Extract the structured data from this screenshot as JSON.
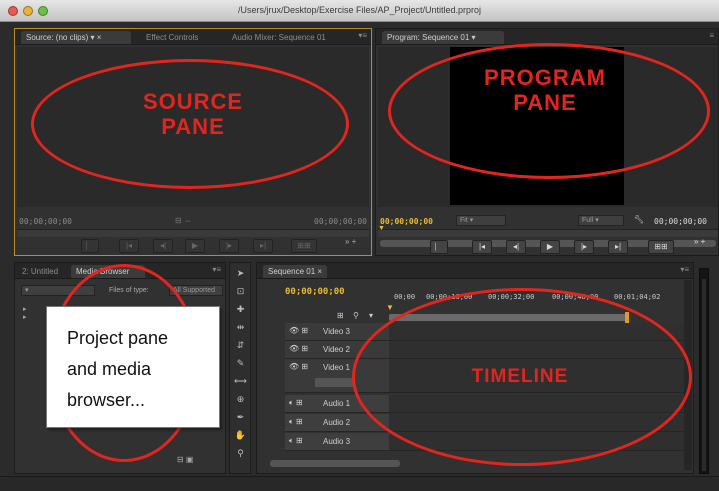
{
  "window": {
    "title": "/Users/jrux/Desktop/Exercise Files/AP_Project/Untitled.prproj"
  },
  "source_panel": {
    "tabs": [
      "Source: (no clips)",
      "Effect Controls",
      "Audio Mixer: Sequence 01"
    ],
    "timecode_in": "00;00;00;00",
    "timecode_out": "00;00;00;00"
  },
  "program_panel": {
    "tab": "Program: Sequence 01",
    "timecode_current": "00;00;00;00",
    "fit_label": "Fit",
    "quality_label": "Full",
    "timecode_duration": "00;00;00;00"
  },
  "project_panel": {
    "tabs": [
      "2: Untitled",
      "Media Browser"
    ],
    "files_of_type_label": "Files of type:",
    "files_of_type_value": "All Supported"
  },
  "timeline_panel": {
    "tab": "Sequence 01",
    "timecode": "00;00;00;00",
    "ruler_ticks": [
      "00;00",
      "00;00;16;00",
      "00;00;32;00",
      "00;00;48;00",
      "00;01;04;02"
    ],
    "tracks": [
      {
        "name": "Video 3",
        "kind": "video"
      },
      {
        "name": "Video 2",
        "kind": "video"
      },
      {
        "name": "Video 1",
        "kind": "video"
      },
      {
        "name": "Audio 1",
        "kind": "audio"
      },
      {
        "name": "Audio 2",
        "kind": "audio"
      },
      {
        "name": "Audio 3",
        "kind": "audio"
      }
    ]
  },
  "annotations": {
    "source": "SOURCE\nPANE",
    "program": "PROGRAM\nPANE",
    "timeline": "TIMELINE",
    "callout": "Project pane\nand media\nbrowser...",
    "color": "#e1261f"
  },
  "colors": {
    "accent_timecode": "#e9bb32",
    "active_panel_border": "#b98c2b"
  }
}
